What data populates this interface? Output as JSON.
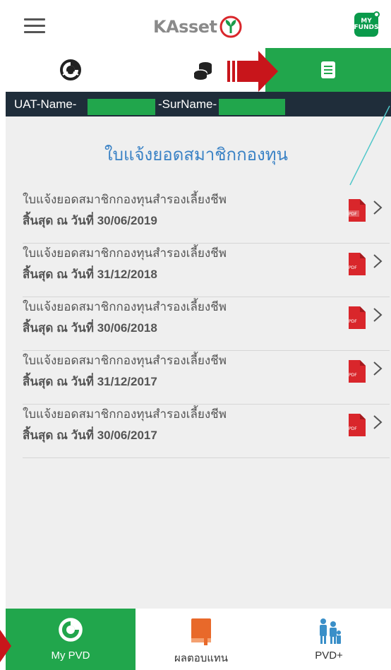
{
  "header": {
    "logo_text": "KAsset",
    "badge_text": "MY FUNDS"
  },
  "tabs": [
    {
      "name": "overview",
      "icon": "pie-chart-icon"
    },
    {
      "name": "funds",
      "icon": "coins-icon"
    },
    {
      "name": "statements",
      "icon": "document-icon",
      "active": true
    }
  ],
  "user": {
    "name_prefix": "UAT-Name-",
    "surname_prefix": "-SurName-"
  },
  "page": {
    "title": "ใบแจ้งยอดสมาชิกกองทุน"
  },
  "statements": [
    {
      "title": "ใบแจ้งยอดสมาชิกกองทุนสำรองเลี้ยงชีพ",
      "date": "สิ้นสุด ณ วันที่ 30/06/2019"
    },
    {
      "title": "ใบแจ้งยอดสมาชิกกองทุนสำรองเลี้ยงชีพ",
      "date": "สิ้นสุด ณ วันที่ 31/12/2018"
    },
    {
      "title": "ใบแจ้งยอดสมาชิกกองทุนสำรองเลี้ยงชีพ",
      "date": "สิ้นสุด ณ วันที่ 30/06/2018"
    },
    {
      "title": "ใบแจ้งยอดสมาชิกกองทุนสำรองเลี้ยงชีพ",
      "date": "สิ้นสุด ณ วันที่ 31/12/2017"
    },
    {
      "title": "ใบแจ้งยอดสมาชิกกองทุนสำรองเลี้ยงชีพ",
      "date": "สิ้นสุด ณ วันที่ 30/06/2017"
    }
  ],
  "bottom_nav": [
    {
      "label": "My PVD",
      "active": true
    },
    {
      "label": "ผลตอบแทน"
    },
    {
      "label": "PVD+"
    }
  ],
  "colors": {
    "accent_green": "#21a64c",
    "title_blue": "#3a82c5",
    "annotation_red": "#c8151b",
    "pdf_red": "#d9262b",
    "annotation_teal": "#4fc7c9"
  }
}
